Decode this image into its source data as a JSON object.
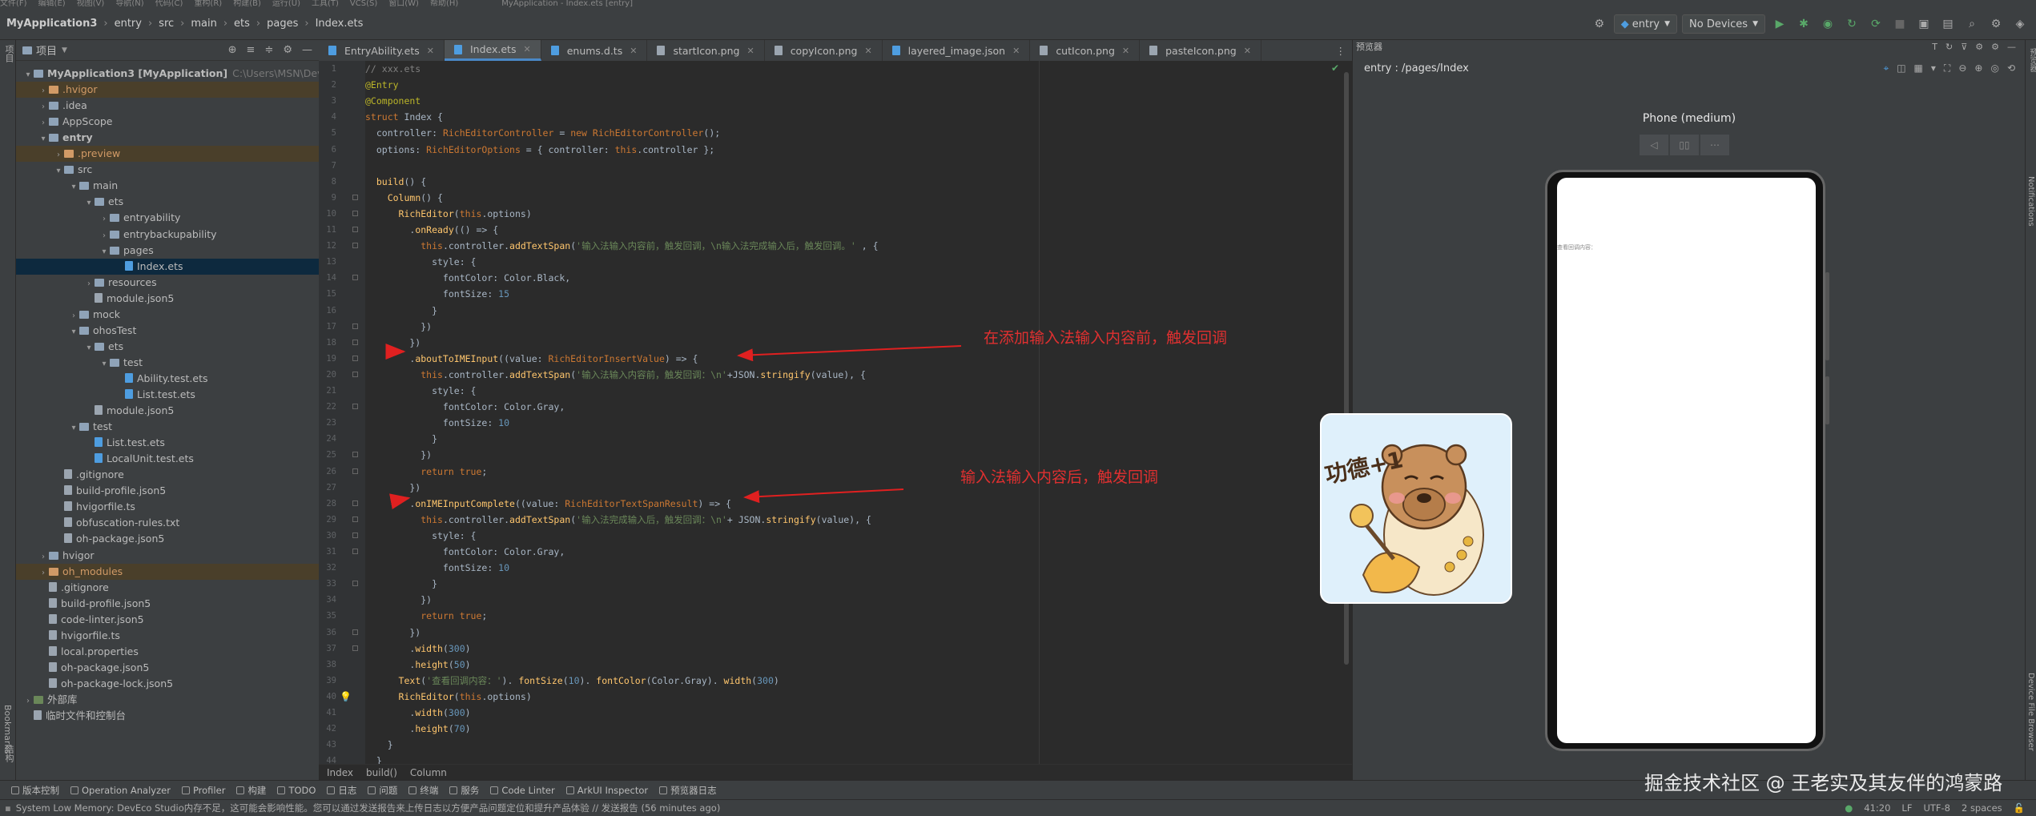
{
  "menubar": {
    "items": [
      "文件(F)",
      "编辑(E)",
      "视图(V)",
      "导航(N)",
      "代码(C)",
      "重构(R)",
      "构建(B)",
      "运行(U)",
      "工具(T)",
      "VCS(S)",
      "窗口(W)",
      "帮助(H)"
    ],
    "title": "MyApplication - Index.ets [entry]"
  },
  "nav": {
    "crumbs": [
      "MyApplication3",
      "entry",
      "src",
      "main",
      "ets",
      "pages",
      "Index.ets"
    ],
    "run_config": "entry",
    "device": "No Devices"
  },
  "project": {
    "title": "项目",
    "tree": [
      {
        "label": "MyApplication3 [MyApplication]",
        "extra": "C:\\Users\\MSN\\DevEco",
        "indent": 0,
        "arrow": "▾",
        "icon": "folder",
        "bold": true
      },
      {
        "label": ".hvigor",
        "indent": 1,
        "arrow": "›",
        "icon": "folder orange",
        "hl": true
      },
      {
        "label": ".idea",
        "indent": 1,
        "arrow": "›",
        "icon": "folder"
      },
      {
        "label": "AppScope",
        "indent": 1,
        "arrow": "›",
        "icon": "folder"
      },
      {
        "label": "entry",
        "indent": 1,
        "arrow": "▾",
        "icon": "folder",
        "bold": true
      },
      {
        "label": ".preview",
        "indent": 2,
        "arrow": "›",
        "icon": "folder orange",
        "hl": true
      },
      {
        "label": "src",
        "indent": 2,
        "arrow": "▾",
        "icon": "folder"
      },
      {
        "label": "main",
        "indent": 3,
        "arrow": "▾",
        "icon": "folder"
      },
      {
        "label": "ets",
        "indent": 4,
        "arrow": "▾",
        "icon": "folder"
      },
      {
        "label": "entryability",
        "indent": 5,
        "arrow": "›",
        "icon": "folder"
      },
      {
        "label": "entrybackupability",
        "indent": 5,
        "arrow": "›",
        "icon": "folder"
      },
      {
        "label": "pages",
        "indent": 5,
        "arrow": "▾",
        "icon": "folder"
      },
      {
        "label": "Index.ets",
        "indent": 6,
        "arrow": "",
        "icon": "ets",
        "sel": true
      },
      {
        "label": "resources",
        "indent": 4,
        "arrow": "›",
        "icon": "folder"
      },
      {
        "label": "module.json5",
        "indent": 4,
        "arrow": "",
        "icon": "file"
      },
      {
        "label": "mock",
        "indent": 3,
        "arrow": "›",
        "icon": "folder"
      },
      {
        "label": "ohosTest",
        "indent": 3,
        "arrow": "▾",
        "icon": "folder"
      },
      {
        "label": "ets",
        "indent": 4,
        "arrow": "▾",
        "icon": "folder"
      },
      {
        "label": "test",
        "indent": 5,
        "arrow": "▾",
        "icon": "folder"
      },
      {
        "label": "Ability.test.ets",
        "indent": 6,
        "arrow": "",
        "icon": "ets"
      },
      {
        "label": "List.test.ets",
        "indent": 6,
        "arrow": "",
        "icon": "ets"
      },
      {
        "label": "module.json5",
        "indent": 4,
        "arrow": "",
        "icon": "file"
      },
      {
        "label": "test",
        "indent": 3,
        "arrow": "▾",
        "icon": "folder"
      },
      {
        "label": "List.test.ets",
        "indent": 4,
        "arrow": "",
        "icon": "ets"
      },
      {
        "label": "LocalUnit.test.ets",
        "indent": 4,
        "arrow": "",
        "icon": "ets"
      },
      {
        "label": ".gitignore",
        "indent": 2,
        "arrow": "",
        "icon": "file"
      },
      {
        "label": "build-profile.json5",
        "indent": 2,
        "arrow": "",
        "icon": "file"
      },
      {
        "label": "hvigorfile.ts",
        "indent": 2,
        "arrow": "",
        "icon": "file"
      },
      {
        "label": "obfuscation-rules.txt",
        "indent": 2,
        "arrow": "",
        "icon": "file"
      },
      {
        "label": "oh-package.json5",
        "indent": 2,
        "arrow": "",
        "icon": "file"
      },
      {
        "label": "hvigor",
        "indent": 1,
        "arrow": "›",
        "icon": "folder"
      },
      {
        "label": "oh_modules",
        "indent": 1,
        "arrow": "›",
        "icon": "folder orange",
        "hl": true
      },
      {
        "label": ".gitignore",
        "indent": 1,
        "arrow": "",
        "icon": "file"
      },
      {
        "label": "build-profile.json5",
        "indent": 1,
        "arrow": "",
        "icon": "file"
      },
      {
        "label": "code-linter.json5",
        "indent": 1,
        "arrow": "",
        "icon": "file"
      },
      {
        "label": "hvigorfile.ts",
        "indent": 1,
        "arrow": "",
        "icon": "file"
      },
      {
        "label": "local.properties",
        "indent": 1,
        "arrow": "",
        "icon": "file"
      },
      {
        "label": "oh-package.json5",
        "indent": 1,
        "arrow": "",
        "icon": "file"
      },
      {
        "label": "oh-package-lock.json5",
        "indent": 1,
        "arrow": "",
        "icon": "file"
      },
      {
        "label": "外部库",
        "indent": 0,
        "arrow": "›",
        "icon": "lib"
      },
      {
        "label": "临时文件和控制台",
        "indent": 0,
        "arrow": "",
        "icon": "file"
      }
    ]
  },
  "tabs": [
    "EntryAbility.ets",
    "Index.ets",
    "enums.d.ts",
    "startIcon.png",
    "copyIcon.png",
    "layered_image.json",
    "cutIcon.png",
    "pasteIcon.png"
  ],
  "active_tab": "Index.ets",
  "code_lines": [
    [
      [
        "cm",
        "// xxx.ets"
      ]
    ],
    [
      [
        "dec",
        "@Entry"
      ]
    ],
    [
      [
        "dec",
        "@Component"
      ]
    ],
    [
      [
        "kw",
        "struct "
      ],
      [
        "ty",
        "Index {"
      ]
    ],
    [
      [
        "ty",
        "  controller: "
      ],
      [
        "kw",
        "RichEditorController"
      ],
      [
        "ty",
        " = "
      ],
      [
        "kw",
        "new "
      ],
      [
        "kw",
        "RichEditorController"
      ],
      [
        "ty",
        "();"
      ]
    ],
    [
      [
        "ty",
        "  options: "
      ],
      [
        "kw",
        "RichEditorOptions"
      ],
      [
        "ty",
        " = { controller: "
      ],
      [
        "kw",
        "this"
      ],
      [
        "ty",
        ".controller };"
      ]
    ],
    [
      [
        "ty",
        ""
      ]
    ],
    [
      [
        "ty",
        "  "
      ],
      [
        "fn",
        "build"
      ],
      [
        "ty",
        "() {"
      ]
    ],
    [
      [
        "ty",
        "    "
      ],
      [
        "fn",
        "Column"
      ],
      [
        "ty",
        "() {"
      ]
    ],
    [
      [
        "ty",
        "      "
      ],
      [
        "fn",
        "RichEditor"
      ],
      [
        "ty",
        "("
      ],
      [
        "kw",
        "this"
      ],
      [
        "ty",
        ".options)"
      ]
    ],
    [
      [
        "ty",
        "        ."
      ],
      [
        "method",
        "onReady"
      ],
      [
        "ty",
        "(() => {"
      ]
    ],
    [
      [
        "ty",
        "          "
      ],
      [
        "kw",
        "this"
      ],
      [
        "ty",
        ".controller."
      ],
      [
        "method",
        "addTextSpan"
      ],
      [
        "ty",
        "("
      ],
      [
        "str",
        "'输入法输入内容前，触发回调，\\n输入法完成输入后，触发回调。'"
      ],
      [
        "ty",
        " , {"
      ]
    ],
    [
      [
        "ty",
        "            style: {"
      ]
    ],
    [
      [
        "ty",
        "              fontColor: Color.Black,"
      ]
    ],
    [
      [
        "ty",
        "              fontSize: "
      ],
      [
        "num",
        "15"
      ]
    ],
    [
      [
        "ty",
        "            }"
      ]
    ],
    [
      [
        "ty",
        "          })"
      ]
    ],
    [
      [
        "ty",
        "        })"
      ]
    ],
    [
      [
        "ty",
        "        ."
      ],
      [
        "method",
        "aboutToIMEInput"
      ],
      [
        "ty",
        "((value: "
      ],
      [
        "kw",
        "RichEditorInsertValue"
      ],
      [
        "ty",
        ") => {"
      ]
    ],
    [
      [
        "ty",
        "          "
      ],
      [
        "kw",
        "this"
      ],
      [
        "ty",
        ".controller."
      ],
      [
        "method",
        "addTextSpan"
      ],
      [
        "ty",
        "("
      ],
      [
        "str",
        "'输入法输入内容前，触发回调：\\n'"
      ],
      [
        "ty",
        "+JSON."
      ],
      [
        "method",
        "stringify"
      ],
      [
        "ty",
        "(value), {"
      ]
    ],
    [
      [
        "ty",
        "            style: {"
      ]
    ],
    [
      [
        "ty",
        "              fontColor: Color.Gray,"
      ]
    ],
    [
      [
        "ty",
        "              fontSize: "
      ],
      [
        "num",
        "10"
      ]
    ],
    [
      [
        "ty",
        "            }"
      ]
    ],
    [
      [
        "ty",
        "          })"
      ]
    ],
    [
      [
        "ty",
        "          "
      ],
      [
        "kw",
        "return true"
      ],
      [
        "ty",
        ";"
      ]
    ],
    [
      [
        "ty",
        "        })"
      ]
    ],
    [
      [
        "ty",
        "        ."
      ],
      [
        "method",
        "onIMEInputComplete"
      ],
      [
        "ty",
        "((value: "
      ],
      [
        "kw",
        "RichEditorTextSpanResult"
      ],
      [
        "ty",
        ") => {"
      ]
    ],
    [
      [
        "ty",
        "          "
      ],
      [
        "kw",
        "this"
      ],
      [
        "ty",
        ".controller."
      ],
      [
        "method",
        "addTextSpan"
      ],
      [
        "ty",
        "("
      ],
      [
        "str",
        "'输入法完成输入后，触发回调：\\n'"
      ],
      [
        "ty",
        "+ JSON."
      ],
      [
        "method",
        "stringify"
      ],
      [
        "ty",
        "(value), {"
      ]
    ],
    [
      [
        "ty",
        "            style: {"
      ]
    ],
    [
      [
        "ty",
        "              fontColor: Color.Gray,"
      ]
    ],
    [
      [
        "ty",
        "              fontSize: "
      ],
      [
        "num",
        "10"
      ]
    ],
    [
      [
        "ty",
        "            }"
      ]
    ],
    [
      [
        "ty",
        "          })"
      ]
    ],
    [
      [
        "ty",
        "          "
      ],
      [
        "kw",
        "return true"
      ],
      [
        "ty",
        ";"
      ]
    ],
    [
      [
        "ty",
        "        })"
      ]
    ],
    [
      [
        "ty",
        "        ."
      ],
      [
        "method",
        "width"
      ],
      [
        "ty",
        "("
      ],
      [
        "num",
        "300"
      ],
      [
        "ty",
        ")"
      ]
    ],
    [
      [
        "ty",
        "        ."
      ],
      [
        "method",
        "height"
      ],
      [
        "ty",
        "("
      ],
      [
        "num",
        "50"
      ],
      [
        "ty",
        ")"
      ]
    ],
    [
      [
        "ty",
        "      "
      ],
      [
        "fn",
        "Text"
      ],
      [
        "ty",
        "("
      ],
      [
        "str",
        "'查看回调内容：'"
      ],
      [
        "ty",
        "). "
      ],
      [
        "method",
        "fontSize"
      ],
      [
        "ty",
        "("
      ],
      [
        "num",
        "10"
      ],
      [
        "ty",
        "). "
      ],
      [
        "method",
        "fontColor"
      ],
      [
        "ty",
        "(Color.Gray). "
      ],
      [
        "method",
        "width"
      ],
      [
        "ty",
        "("
      ],
      [
        "num",
        "300"
      ],
      [
        "ty",
        ")"
      ]
    ],
    [
      [
        "ty",
        "      "
      ],
      [
        "fn",
        "RichEditor"
      ],
      [
        "ty",
        "("
      ],
      [
        "kw",
        "this"
      ],
      [
        "ty",
        ".options)"
      ]
    ],
    [
      [
        "ty",
        "        ."
      ],
      [
        "method",
        "width"
      ],
      [
        "ty",
        "("
      ],
      [
        "num",
        "300"
      ],
      [
        "ty",
        ")"
      ]
    ],
    [
      [
        "ty",
        "        ."
      ],
      [
        "method",
        "height"
      ],
      [
        "ty",
        "("
      ],
      [
        "num",
        "70"
      ],
      [
        "ty",
        ")"
      ]
    ],
    [
      [
        "ty",
        "    }"
      ]
    ],
    [
      [
        "ty",
        "  }"
      ]
    ]
  ],
  "annotations": {
    "before": "在添加输入法输入内容前，触发回调",
    "after": "输入法输入内容后，触发回调"
  },
  "code_breadcrumb": [
    "Index",
    "build()",
    "Column"
  ],
  "preview": {
    "title": "预览器",
    "path": "entry : /pages/Index",
    "device": "Phone (medium)",
    "screen_text": "查看回调内容："
  },
  "sticker_text": "功德+1",
  "tool_windows": [
    "版本控制",
    "Operation Analyzer",
    "Profiler",
    "构建",
    "TODO",
    "日志",
    "问题",
    "终端",
    "服务",
    "Code Linter",
    "ArkUI Inspector",
    "预览器日志"
  ],
  "status": {
    "message": "System Low Memory: DevEco Studio内存不足，这可能会影响性能。您可以通过发送报告来上传日志以方便产品问题定位和提升产品体验 // 发送报告 (56 minutes ago)",
    "position": "41:20",
    "line_sep": "LF",
    "encoding": "UTF-8",
    "indent": "2 spaces"
  },
  "watermark": "掘金技术社区 @ 王老实及其友伴的鸿蒙路",
  "left_strip": [
    "项目",
    "Bookmarks",
    "结构"
  ],
  "right_strip": [
    "预览器",
    "Notifications",
    "Device File Browser"
  ]
}
